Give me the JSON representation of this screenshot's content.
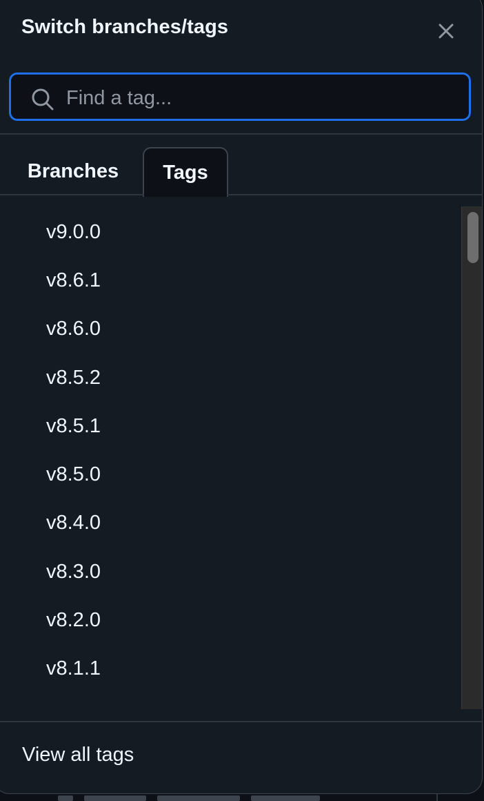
{
  "header": {
    "title": "Switch branches/tags"
  },
  "search": {
    "placeholder": "Find a tag..."
  },
  "tabs": [
    {
      "label": "Branches",
      "selected": false
    },
    {
      "label": "Tags",
      "selected": true
    }
  ],
  "tags": [
    "v9.0.0",
    "v8.6.1",
    "v8.6.0",
    "v8.5.2",
    "v8.5.1",
    "v8.5.0",
    "v8.4.0",
    "v8.3.0",
    "v8.2.0",
    "v8.1.1"
  ],
  "footer": {
    "view_all_label": "View all tags"
  },
  "icons": {
    "close": "close-icon",
    "search": "search-icon"
  },
  "colors": {
    "panel_bg": "#151b23",
    "focus_border": "#1f6feb",
    "text": "#f0f6fc",
    "muted_text": "#9198a1"
  }
}
